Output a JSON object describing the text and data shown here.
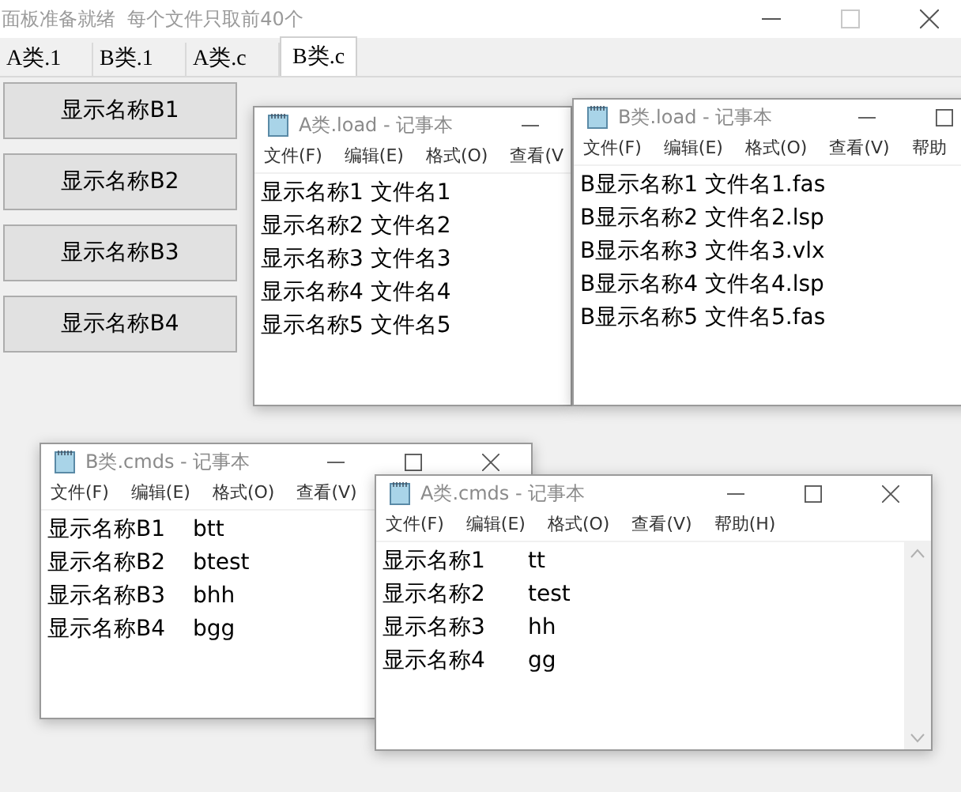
{
  "window": {
    "title": "面板准备就绪  每个文件只取前40个",
    "controls": [
      {
        "kind": "minimize",
        "disabled": false
      },
      {
        "kind": "maximize",
        "disabled": true
      },
      {
        "kind": "close",
        "disabled": false
      }
    ]
  },
  "tabs": [
    {
      "label": "A类.1",
      "selected": false
    },
    {
      "label": "B类.1",
      "selected": false
    },
    {
      "label": "A类.c",
      "selected": false
    },
    {
      "label": "B类.c",
      "selected": true
    }
  ],
  "buttons": [
    "显示名称B1",
    "显示名称B2",
    "显示名称B3",
    "显示名称B4"
  ],
  "notepads": [
    {
      "title": "A类.load - 记事本",
      "controls": [
        {
          "kind": "minimize"
        }
      ],
      "menu": [
        "文件(F)",
        "编辑(E)",
        "格式(O)",
        "查看(V"
      ],
      "lines": [
        [
          "显示名称1 文件名1"
        ],
        [
          "显示名称2 文件名2"
        ],
        [
          "显示名称3 文件名3"
        ],
        [
          "显示名称4 文件名4"
        ],
        [
          "显示名称5 文件名5"
        ]
      ]
    },
    {
      "title": "B类.load - 记事本",
      "controls": [
        {
          "kind": "minimize"
        },
        {
          "kind": "maximize"
        }
      ],
      "menu": [
        "文件(F)",
        "编辑(E)",
        "格式(O)",
        "查看(V)",
        "帮助"
      ],
      "lines": [
        [
          "B显示名称1 文件名1.fas"
        ],
        [
          "B显示名称2 文件名2.lsp"
        ],
        [
          "B显示名称3 文件名3.vlx"
        ],
        [
          "B显示名称4 文件名4.lsp"
        ],
        [
          "B显示名称5 文件名5.fas"
        ]
      ]
    },
    {
      "title": "B类.cmds - 记事本",
      "controls": [
        {
          "kind": "minimize"
        },
        {
          "kind": "maximize"
        },
        {
          "kind": "close"
        }
      ],
      "menu": [
        "文件(F)",
        "编辑(E)",
        "格式(O)",
        "查看(V)"
      ],
      "lines": [
        [
          "显示名称B1",
          "btt"
        ],
        [
          "显示名称B2",
          "btest"
        ],
        [
          "显示名称B3",
          "bhh"
        ],
        [
          "显示名称B4",
          "bgg"
        ]
      ]
    },
    {
      "title": "A类.cmds - 记事本",
      "controls": [
        {
          "kind": "minimize"
        },
        {
          "kind": "maximize"
        },
        {
          "kind": "close"
        }
      ],
      "menu": [
        "文件(F)",
        "编辑(E)",
        "格式(O)",
        "查看(V)",
        "帮助(H)"
      ],
      "lines": [
        [
          "显示名称1",
          "tt"
        ],
        [
          "显示名称2",
          "test"
        ],
        [
          "显示名称3",
          "hh"
        ],
        [
          "显示名称4",
          "gg"
        ]
      ],
      "scrollbar": true
    }
  ]
}
